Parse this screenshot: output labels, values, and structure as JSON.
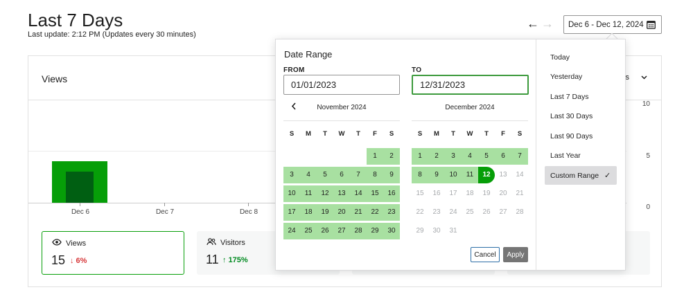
{
  "header": {
    "title": "Last 7 Days",
    "subtitle": "Last update: 2:12 PM (Updates every 30 minutes)",
    "prev_arrow": "←",
    "next_arrow": "→",
    "date_button_label": "Dec 6 - Dec 12, 2024",
    "calendar_icon": "calendar-icon"
  },
  "card": {
    "title": "Views",
    "period_select": "ys",
    "y_ticks": [
      "10",
      "5",
      "0"
    ],
    "x_ticks": [
      "Dec 6",
      "Dec 7",
      "Dec 8"
    ]
  },
  "stats": [
    {
      "label": "Views",
      "icon": "eye-icon",
      "value": "15",
      "delta": "↓ 6%",
      "direction": "down"
    },
    {
      "label": "Visitors",
      "icon": "people-icon",
      "value": "11",
      "delta": "↑ 175%",
      "direction": "up"
    }
  ],
  "popover": {
    "title": "Date Range",
    "from_label": "FROM",
    "to_label": "TO",
    "from_value": "01/01/2023",
    "to_value": "12/31/2023",
    "prev_month_icon": "chevron-left-icon",
    "left_month": "November 2024",
    "right_month": "December 2024",
    "weekdays": [
      "S",
      "M",
      "T",
      "W",
      "T",
      "F",
      "S"
    ],
    "cancel_label": "Cancel",
    "apply_label": "Apply",
    "presets": [
      "Today",
      "Yesterday",
      "Last 7 Days",
      "Last 30 Days",
      "Last 90 Days",
      "Last Year",
      "Custom Range"
    ],
    "active_preset": "Custom Range",
    "check_mark": "✓"
  },
  "calendars": {
    "november": {
      "leading_blanks": 5,
      "days": [
        "1",
        "2",
        "3",
        "4",
        "5",
        "6",
        "7",
        "8",
        "9",
        "10",
        "11",
        "12",
        "13",
        "14",
        "15",
        "16",
        "17",
        "18",
        "19",
        "20",
        "21",
        "22",
        "23",
        "24",
        "25",
        "26",
        "27",
        "28",
        "29",
        "30"
      ],
      "in_range_from": 1,
      "in_range_to": 30
    },
    "december": {
      "leading_blanks": 0,
      "days": [
        "1",
        "2",
        "3",
        "4",
        "5",
        "6",
        "7",
        "8",
        "9",
        "10",
        "11",
        "12",
        "13",
        "14",
        "15",
        "16",
        "17",
        "18",
        "19",
        "20",
        "21",
        "22",
        "23",
        "24",
        "25",
        "26",
        "27",
        "28",
        "29",
        "30",
        "31"
      ],
      "in_range_to": 11,
      "selected": 12
    }
  },
  "colors": {
    "accent": "#069e08",
    "range": "#a8e0a1",
    "bar_dark": "#005f12",
    "delta_down": "#d63638",
    "delta_up": "#008a20"
  }
}
